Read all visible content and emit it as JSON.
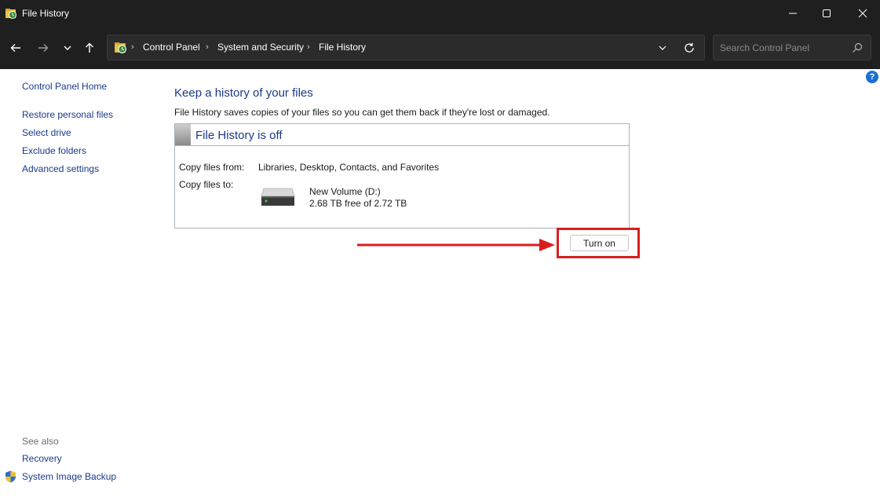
{
  "window": {
    "title": "File History",
    "controls": {
      "minimize_icon": "minimize-icon",
      "maximize_icon": "maximize-icon",
      "close_icon": "close-icon"
    }
  },
  "address_bar": {
    "breadcrumbs": [
      "Control Panel",
      "System and Security",
      "File History"
    ],
    "separator": "›",
    "search_placeholder": "Search Control Panel"
  },
  "sidebar": {
    "home": "Control Panel Home",
    "links": [
      "Restore personal files",
      "Select drive",
      "Exclude folders",
      "Advanced settings"
    ],
    "see_also_label": "See also",
    "see_also": [
      "Recovery",
      "System Image Backup"
    ]
  },
  "main": {
    "heading": "Keep a history of your files",
    "description": "File History saves copies of your files so you can get them back if they're lost or damaged.",
    "status": "File History is off",
    "copy_from_label": "Copy files from:",
    "copy_from_value": "Libraries, Desktop, Contacts, and Favorites",
    "copy_to_label": "Copy files to:",
    "drive_name": "New Volume (D:)",
    "drive_space": "2.68 TB free of 2.72 TB",
    "turn_on_button": "Turn on"
  },
  "annotation": {
    "color": "#d91e1e"
  },
  "help": "?"
}
